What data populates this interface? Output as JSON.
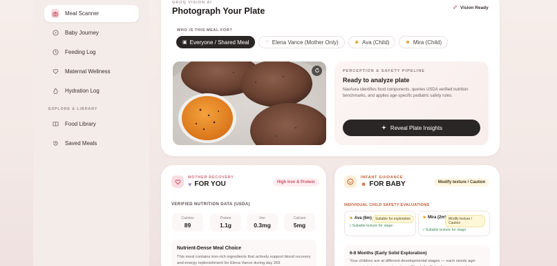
{
  "sidebar": {
    "items": [
      {
        "label": "Meal Scanner",
        "icon": "camera-icon"
      },
      {
        "label": "Baby Journey",
        "icon": "compass-icon"
      },
      {
        "label": "Feeding Log",
        "icon": "clock-icon"
      },
      {
        "label": "Maternal Wellness",
        "icon": "heart-icon"
      },
      {
        "label": "Hydration Log",
        "icon": "drop-icon"
      }
    ],
    "section_label": "EXPLORE & LIBRARY",
    "library_items": [
      {
        "label": "Food Library",
        "icon": "book-icon"
      },
      {
        "label": "Saved Meals",
        "icon": "history-icon"
      }
    ]
  },
  "header": {
    "eyebrow": "GROQ VISION AI",
    "title": "Photograph Your Plate",
    "status": "Vision Ready"
  },
  "audience": {
    "label": "WHO IS THIS MEAL FOR?",
    "chips": [
      {
        "label": "Everyone / Shared Meal",
        "icon": "▣",
        "active": true
      },
      {
        "label": "Elena Vance (Mother Only)",
        "icon": "♡",
        "active": false
      },
      {
        "label": "Ava (Child)",
        "icon": "☻",
        "active": false
      },
      {
        "label": "Mira (Child)",
        "icon": "☻",
        "active": false
      }
    ]
  },
  "pipeline": {
    "eyebrow": "PERCEPTION & SAFETY PIPELINE",
    "title": "Ready to analyze plate",
    "description": "NavAura identifies food components, queries USDA verified nutrition benchmarks, and applies age-specific pediatric safety rules.",
    "button": "Reveal Plate Insights"
  },
  "mother": {
    "eyebrow": "MOTHER RECOVERY",
    "title": "FOR YOU",
    "badge": "High Iron & Protein",
    "nutrition_label": "VERIFIED NUTRITION DATA (USDA)",
    "stats": [
      {
        "label": "Calories",
        "value": "89"
      },
      {
        "label": "Protein",
        "value": "1.1g"
      },
      {
        "label": "Iron",
        "value": "0.3mg"
      },
      {
        "label": "Calcium",
        "value": "5mg"
      }
    ],
    "choice_title": "Nutrient-Dense Meal Choice",
    "choice_desc": "This meal contains iron-rich ingredients that actively support blood recovery and energy replenishment for Elena Vance during day 269"
  },
  "baby": {
    "eyebrow": "INFANT GUIDANCE",
    "title": "FOR BABY",
    "badge": "Modify texture / Caution",
    "section_label": "INDIVIDUAL CHILD SAFETY EVALUATIONS",
    "children": [
      {
        "name": "Ava (6m)",
        "tag": "Suitable for exploration",
        "status": "✓Suitable texture for stage"
      },
      {
        "name": "Mira (2m)",
        "tag": "Modify texture / Caution",
        "status": "✓Suitable texture for stage"
      }
    ],
    "stage_title": "6-8 Months (Early Solid Exploration)",
    "stage_desc": "Your children are at different developmental stages — each needs age-appropriate textures and portions. Check the Baby Journey page for"
  },
  "colors": {
    "accent": "#c45466",
    "dark": "#2a2626",
    "baby_accent": "#c0582e"
  }
}
